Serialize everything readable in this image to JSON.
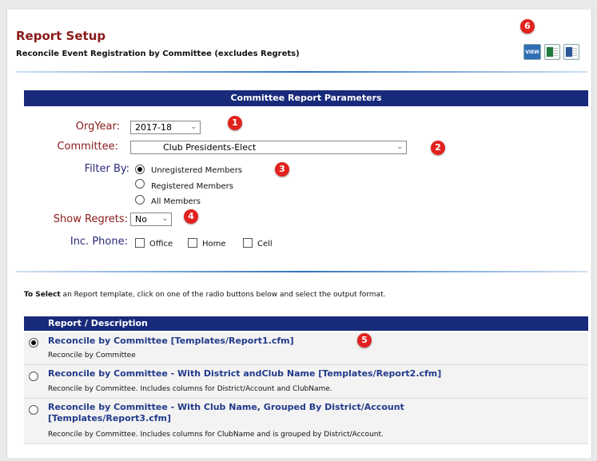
{
  "header": {
    "title": "Report Setup",
    "subtitle": "Reconcile Event Registration by Committee (excludes Regrets)",
    "export_view_label": "VIEW"
  },
  "params": {
    "bar_title": "Committee Report Parameters",
    "orgyear": {
      "label": "OrgYear:",
      "value": "2017-18"
    },
    "committee": {
      "label": "Committee:",
      "value": "Club Presidents-Elect"
    },
    "filter_by": {
      "label": "Filter By:",
      "options": [
        "Unregistered Members",
        "Registered Members",
        "All Members"
      ],
      "selected": "Unregistered Members"
    },
    "show_regrets": {
      "label": "Show Regrets:",
      "value": "No"
    },
    "inc_phone": {
      "label": "Inc. Phone:",
      "options": [
        "Office",
        "Home",
        "Cell"
      ]
    }
  },
  "instructions": {
    "bold": "To Select",
    "text": " an Report template, click on one of the radio buttons below and select the output format."
  },
  "reports": {
    "header": "Report / Description",
    "items": [
      {
        "title": "Reconcile by Committee [Templates/Report1.cfm]",
        "desc": "Reconcile by Committee",
        "selected": true
      },
      {
        "title": "Reconcile by Committee - With District andClub Name [Templates/Report2.cfm]",
        "desc": "Reconcile by Committee. Includes columns for District/Account and ClubName.",
        "selected": false
      },
      {
        "title": "Reconcile by Committee - With Club Name, Grouped By District/Account",
        "title2": "[Templates/Report3.cfm]",
        "desc": "Reconcile by Committee. Includes columns for ClubName and is grouped by District/Account.",
        "selected": false
      }
    ]
  },
  "badges": [
    "1",
    "2",
    "3",
    "4",
    "5",
    "6"
  ],
  "colors": {
    "title": "#8b1a1a",
    "bar": "#182a7a",
    "link": "#223a8a",
    "badge": "#e2221e"
  }
}
